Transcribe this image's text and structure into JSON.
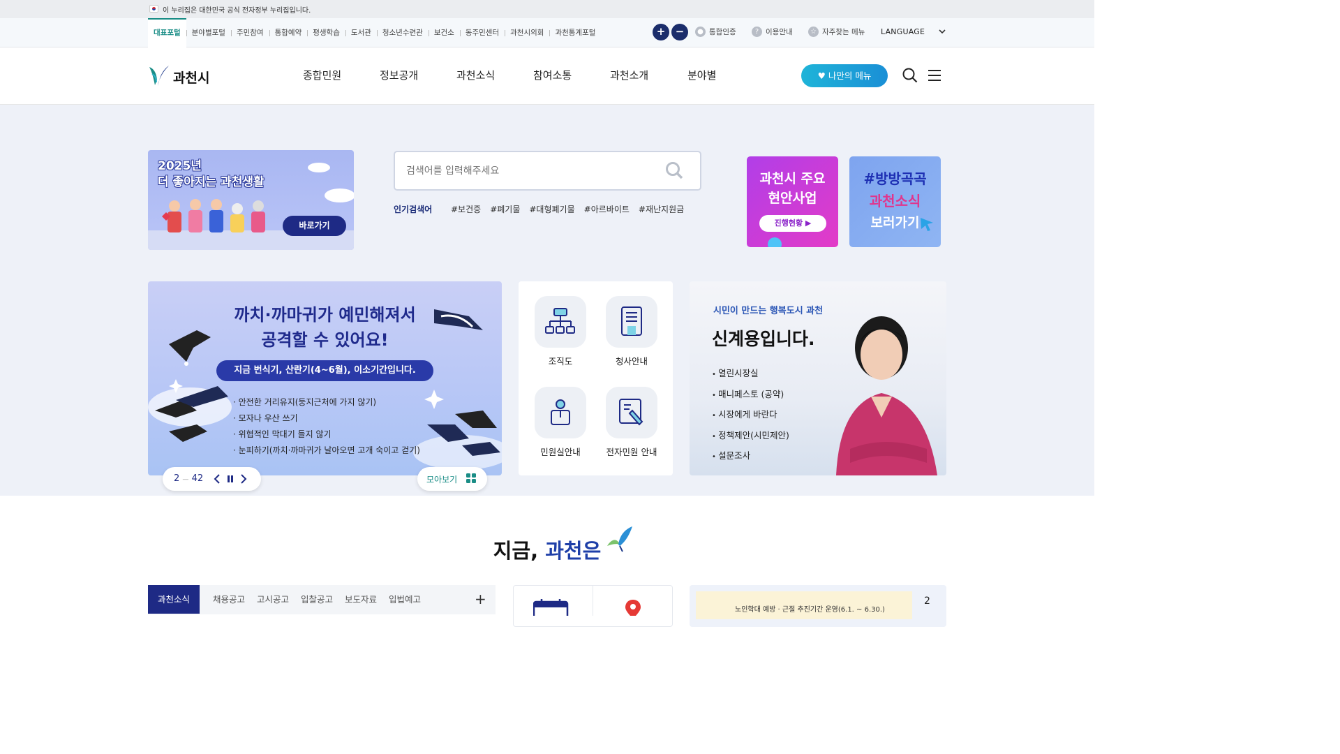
{
  "gov_banner": {
    "text": "이 누리집은 대한민국 공식 전자정부 누리집입니다."
  },
  "portal": {
    "links": [
      "대표포털",
      "분야별포털",
      "주민참여",
      "통합예약",
      "평생학습",
      "도서관",
      "청소년수련관",
      "보건소",
      "동주민센터",
      "과천시의회",
      "과천통계포털"
    ],
    "zoom_in": "+",
    "zoom_out": "−",
    "util": [
      {
        "icon": "person-icon",
        "label": "통합인증"
      },
      {
        "icon": "question-icon",
        "label": "이용안내"
      },
      {
        "icon": "star-icon",
        "label": "자주찾는 메뉴"
      }
    ],
    "language": "LANGUAGE"
  },
  "header": {
    "logo_text": "과천시",
    "gnb": [
      "종합민원",
      "정보공개",
      "과천소식",
      "참여소통",
      "과천소개",
      "분야별"
    ],
    "my_menu": "♥ 나만의 메뉴"
  },
  "promo_left": {
    "title_line1": "2025년",
    "title_line2": "더 좋아지는 과천생활",
    "button": "바로가기"
  },
  "search": {
    "placeholder": "검색어를 입력해주세요",
    "popular_label": "인기검색어",
    "popular_tags": [
      "#보건증",
      "#폐기물",
      "#대형폐기물",
      "#아르바이트",
      "#재난지원금"
    ]
  },
  "promo_right1": {
    "line1": "과천시 주요",
    "line2": "현안사업",
    "button": "진행현황 ▶"
  },
  "promo_right2": {
    "line1": "#방방곡곡",
    "line2": "과천소식",
    "line3": "보러가기"
  },
  "main_banner": {
    "title_line1": "까치·까마귀가 예민해져서",
    "title_line2": "공격할 수 있어요!",
    "pill": "지금 번식기, 산란기(4~6월), 이소기간입니다.",
    "items": [
      "안전한 거리유지(둥지근처에 가지 않기)",
      "모자나 우산 쓰기",
      "위협적인 막대기 들지 않기",
      "눈피하기(까치·까마귀가 날아오면 고개 숙이고 걷기)"
    ],
    "pager_current": "2",
    "pager_sep": "—",
    "pager_total": "42",
    "more": "모아보기"
  },
  "quick_menu": [
    {
      "icon": "org-chart-icon",
      "label": "조직도"
    },
    {
      "icon": "building-icon",
      "label": "청사안내"
    },
    {
      "icon": "civil-service-icon",
      "label": "민원실안내"
    },
    {
      "icon": "e-petition-icon",
      "label": "전자민원 안내"
    }
  ],
  "mayor": {
    "slogan": "시민이 만드는 행복도시 과천",
    "name": "신계용입니다.",
    "items": [
      "열린시장실",
      "매니페스토 (공약)",
      "시장에게 바란다",
      "정책제안(시민제안)",
      "설문조사"
    ]
  },
  "now": {
    "title_prefix": "지금, ",
    "title_accent": "과천은",
    "tabs": [
      "과천소식",
      "채용공고",
      "고시공고",
      "입찰공고",
      "보도자료",
      "입법예고"
    ],
    "plus": "+",
    "card3_text": "노인학대 예방 · 근절 추진기간 운영(6.1. ~ 6.30.)",
    "card3_num": "2"
  },
  "colors": {
    "accent": "#1e2a85",
    "teal": "#1a8d86",
    "cyan": "#1fb4d8"
  }
}
